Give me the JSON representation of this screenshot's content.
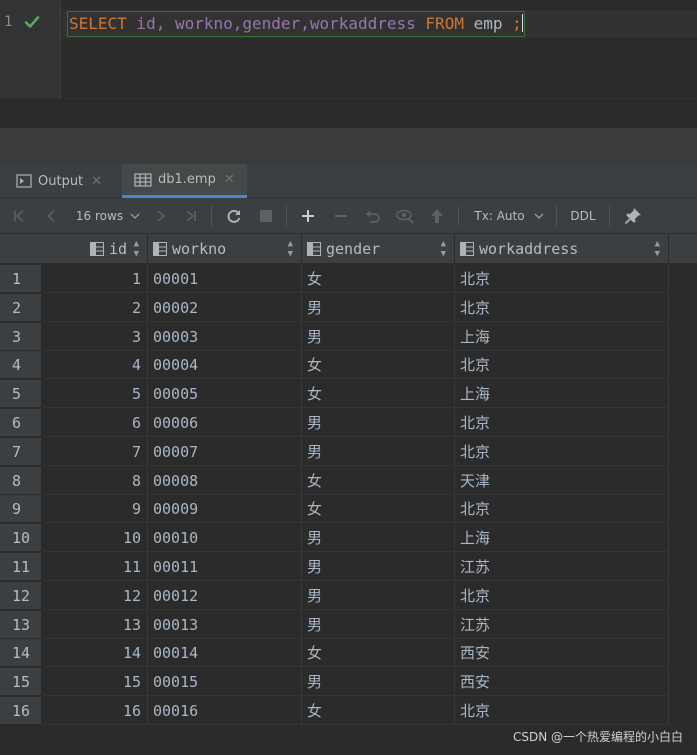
{
  "editor": {
    "line_number": "1",
    "sql": {
      "select": "SELECT",
      "cols": " id, workno,gender,workaddress ",
      "from": "FROM",
      "table": " emp ",
      "semi": ";"
    }
  },
  "tabs": [
    {
      "label": "Output",
      "icon": "output-icon"
    },
    {
      "label": "db1.emp",
      "icon": "table-icon"
    }
  ],
  "toolbar": {
    "rows_label": "16 rows",
    "tx_label": "Tx: Auto",
    "ddl_label": "DDL"
  },
  "columns": [
    "id",
    "workno",
    "gender",
    "workaddress"
  ],
  "rows": [
    {
      "n": "1",
      "id": "1",
      "workno": "00001",
      "gender": "女",
      "workaddress": "北京"
    },
    {
      "n": "2",
      "id": "2",
      "workno": "00002",
      "gender": "男",
      "workaddress": "北京"
    },
    {
      "n": "3",
      "id": "3",
      "workno": "00003",
      "gender": "男",
      "workaddress": "上海"
    },
    {
      "n": "4",
      "id": "4",
      "workno": "00004",
      "gender": "女",
      "workaddress": "北京"
    },
    {
      "n": "5",
      "id": "5",
      "workno": "00005",
      "gender": "女",
      "workaddress": "上海"
    },
    {
      "n": "6",
      "id": "6",
      "workno": "00006",
      "gender": "男",
      "workaddress": "北京"
    },
    {
      "n": "7",
      "id": "7",
      "workno": "00007",
      "gender": "男",
      "workaddress": "北京"
    },
    {
      "n": "8",
      "id": "8",
      "workno": "00008",
      "gender": "女",
      "workaddress": "天津"
    },
    {
      "n": "9",
      "id": "9",
      "workno": "00009",
      "gender": "女",
      "workaddress": "北京"
    },
    {
      "n": "10",
      "id": "10",
      "workno": "00010",
      "gender": "男",
      "workaddress": "上海"
    },
    {
      "n": "11",
      "id": "11",
      "workno": "00011",
      "gender": "男",
      "workaddress": "江苏"
    },
    {
      "n": "12",
      "id": "12",
      "workno": "00012",
      "gender": "男",
      "workaddress": "北京"
    },
    {
      "n": "13",
      "id": "13",
      "workno": "00013",
      "gender": "男",
      "workaddress": "江苏"
    },
    {
      "n": "14",
      "id": "14",
      "workno": "00014",
      "gender": "女",
      "workaddress": "西安"
    },
    {
      "n": "15",
      "id": "15",
      "workno": "00015",
      "gender": "男",
      "workaddress": "西安"
    },
    {
      "n": "16",
      "id": "16",
      "workno": "00016",
      "gender": "女",
      "workaddress": "北京"
    }
  ],
  "watermark": "CSDN @一个热爱编程的小白白"
}
